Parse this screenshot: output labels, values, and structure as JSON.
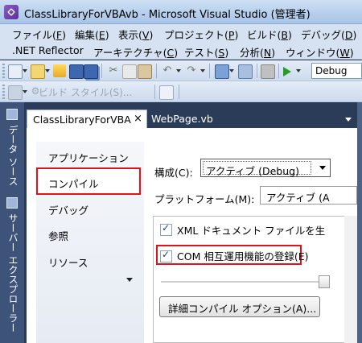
{
  "window": {
    "title": "ClassLibraryForVBAvb - Microsoft Visual Studio (管理者)"
  },
  "menubar1": [
    {
      "label": "ファイル(",
      "key": "F",
      "tail": ")"
    },
    {
      "label": "編集(",
      "key": "E",
      "tail": ")"
    },
    {
      "label": "表示(",
      "key": "V",
      "tail": ")"
    },
    {
      "label": "プロジェクト(",
      "key": "P",
      "tail": ")"
    },
    {
      "label": "ビルド(",
      "key": "B",
      "tail": ")"
    },
    {
      "label": "デバッグ(",
      "key": "D",
      "tail": ")"
    }
  ],
  "menubar2": [
    {
      "label": ".NET Reflector",
      "key": "",
      "tail": ""
    },
    {
      "label": "アーキテクチャ(",
      "key": "C",
      "tail": ")"
    },
    {
      "label": "テスト(",
      "key": "S",
      "tail": ")"
    },
    {
      "label": "分析(",
      "key": "N",
      "tail": ")"
    },
    {
      "label": "ウィンドウ(",
      "key": "W",
      "tail": ")"
    }
  ],
  "toolbar": {
    "solution_config": "Debug",
    "build_style": "ビルド スタイル(S)..."
  },
  "left_strip": {
    "tab1": "データ ソース",
    "tab2": "サーバー エクスプローラー"
  },
  "doc_tabs": {
    "active": "ClassLibraryForVBA",
    "active_close": "×",
    "second": "WebPage.vb"
  },
  "prop_nav": [
    "アプリケーション",
    "コンパイル",
    "デバッグ",
    "参照",
    "リソース"
  ],
  "compile": {
    "config_label": "構成(C):",
    "config_value": "アクティブ (Debug)",
    "platform_label": "プラットフォーム(M):",
    "platform_value": "アクティブ (A",
    "xml_doc_label": "XML ドキュメント ファイルを生",
    "com_interop_label": "COM 相互運用機能の登録(E)",
    "advanced_button": "詳細コンパイル オプション(A)..."
  },
  "colors": {
    "highlight": "#e0131b",
    "background": "#2b3c59"
  }
}
